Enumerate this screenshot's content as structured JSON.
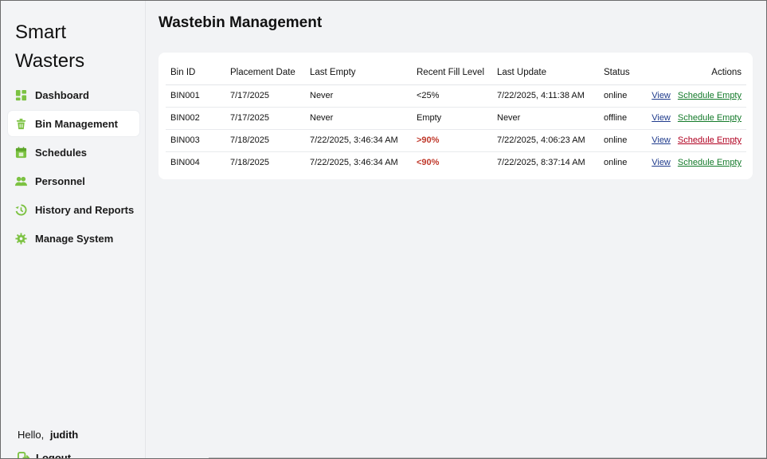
{
  "app": {
    "title_line1": "Smart",
    "title_line2": "Wasters"
  },
  "sidebar": {
    "items": [
      {
        "label": "Dashboard",
        "icon": "dashboard-icon",
        "active": false
      },
      {
        "label": "Bin Management",
        "icon": "trash-bin-icon",
        "active": true
      },
      {
        "label": "Schedules",
        "icon": "calendar-icon",
        "active": false
      },
      {
        "label": "Personnel",
        "icon": "users-icon",
        "active": false
      },
      {
        "label": "History and Reports",
        "icon": "history-icon",
        "active": false
      },
      {
        "label": "Manage System",
        "icon": "gear-icon",
        "active": false
      }
    ],
    "greeting_prefix": "Hello,",
    "username": "judith",
    "logout_label": "Logout"
  },
  "colors": {
    "accent_green": "#7cc242",
    "alert_red": "#b00020",
    "link_blue": "#1f3b8c",
    "link_green": "#137a2a"
  },
  "main": {
    "title": "Wastebin Management",
    "table": {
      "headers": [
        "Bin ID",
        "Placement Date",
        "Last Empty",
        "Recent Fill Level",
        "Last Update",
        "Status",
        "Actions"
      ],
      "rows": [
        {
          "bin_id": "BIN001",
          "placement_date": "7/17/2025",
          "last_empty": "Never",
          "fill_level": "<25%",
          "last_update": "7/22/2025, 4:11:38 AM",
          "status": "online",
          "view": "View",
          "schedule": "Schedule Empty"
        },
        {
          "bin_id": "BIN002",
          "placement_date": "7/17/2025",
          "last_empty": "Never",
          "fill_level": "Empty",
          "last_update": "Never",
          "status": "offline",
          "view": "View",
          "schedule": "Schedule Empty"
        },
        {
          "bin_id": "BIN003",
          "placement_date": "7/18/2025",
          "last_empty": "7/22/2025, 3:46:34 AM",
          "fill_level": ">90%",
          "last_update": "7/22/2025, 4:06:23 AM",
          "status": "online",
          "view": "View",
          "schedule": "Schedule Empty"
        },
        {
          "bin_id": "BIN004",
          "placement_date": "7/18/2025",
          "last_empty": "7/22/2025, 3:46:34 AM",
          "fill_level": "<90%",
          "last_update": "7/22/2025, 8:37:14 AM",
          "status": "online",
          "view": "View",
          "schedule": "Schedule Empty"
        }
      ]
    }
  }
}
